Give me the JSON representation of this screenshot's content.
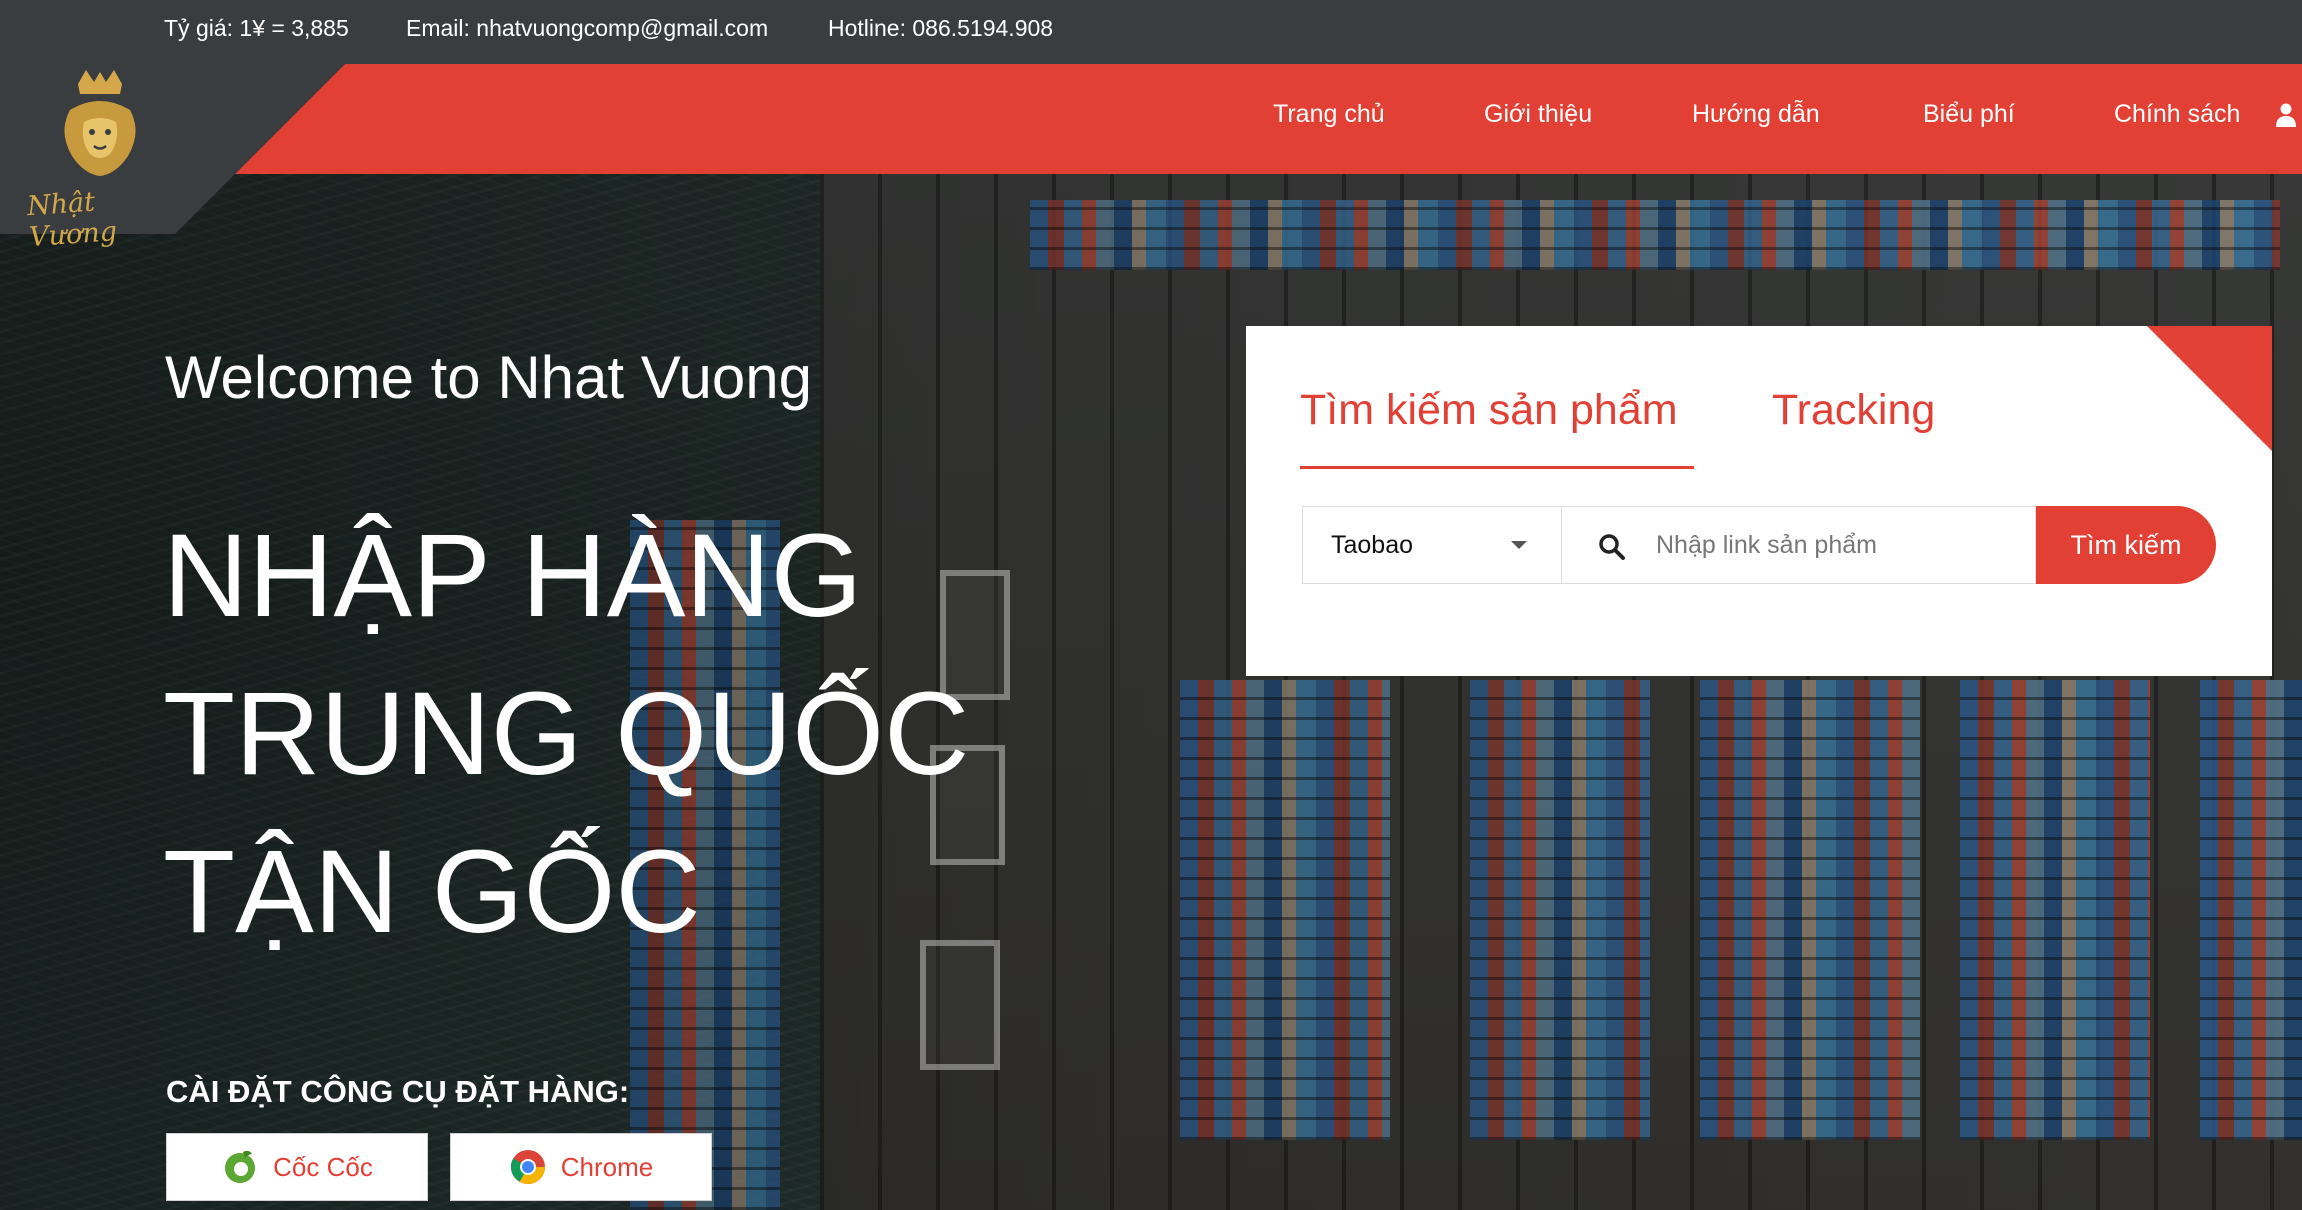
{
  "topbar": {
    "rate": "Tỷ giá: 1¥ = 3,885",
    "email": "Email: nhatvuongcomp@gmail.com",
    "hotline": "Hotline: 086.5194.908"
  },
  "logo": {
    "text": "Nhật Vương"
  },
  "nav": {
    "items": [
      {
        "label": "Trang chủ"
      },
      {
        "label": "Giới thiệu"
      },
      {
        "label": "Hướng dẫn"
      },
      {
        "label": "Biểu phí"
      },
      {
        "label": "Chính sách"
      }
    ]
  },
  "hero": {
    "welcome": "Welcome to Nhat Vuong",
    "headline": [
      "NHẬP HÀNG",
      "TRUNG QUỐC",
      "TẬN GỐC"
    ],
    "install_title": "CÀI ĐẶT CÔNG CỤ ĐẶT HÀNG:",
    "buttons": [
      {
        "label": "Cốc Cốc",
        "icon": "coccoc-icon"
      },
      {
        "label": "Chrome",
        "icon": "chrome-icon"
      }
    ]
  },
  "search_card": {
    "tabs": [
      {
        "label": "Tìm kiếm sản phẩm",
        "active": true
      },
      {
        "label": "Tracking",
        "active": false
      }
    ],
    "source_select": {
      "value": "Taobao"
    },
    "input": {
      "placeholder": "Nhập link sản phẩm",
      "value": ""
    },
    "submit_label": "Tìm kiếm"
  },
  "colors": {
    "accent": "#e23f35",
    "topbar": "#3a3d40",
    "logo_gold": "#d4a84a"
  }
}
